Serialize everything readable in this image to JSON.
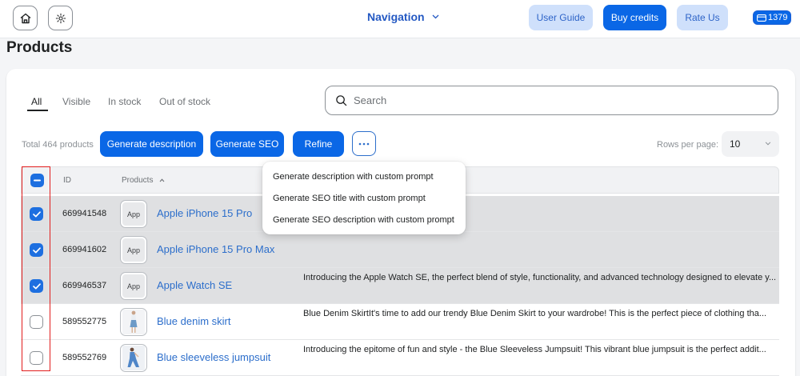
{
  "header": {
    "home_icon": "home-icon",
    "settings_icon": "gear-icon",
    "nav_label": "Navigation",
    "user_guide": "User Guide",
    "buy_credits": "Buy credits",
    "rate_us": "Rate Us",
    "credits_count": "1379"
  },
  "page_title": "Products",
  "tabs": [
    "All",
    "Visible",
    "In stock",
    "Out of stock"
  ],
  "search": {
    "placeholder": "Search"
  },
  "toolbar": {
    "total": "Total 464 products",
    "generate_description": "Generate description",
    "generate_seo": "Generate SEO",
    "refine": "Refine",
    "rows_per_page_label": "Rows per page:",
    "rows_per_page_value": "10"
  },
  "table": {
    "headers": {
      "id": "ID",
      "products": "Products"
    },
    "rows": [
      {
        "id": "669941548",
        "thumb": "App",
        "name": "Apple iPhone 15 Pro",
        "desc": "",
        "selected": true
      },
      {
        "id": "669941602",
        "thumb": "App",
        "name": "Apple iPhone 15 Pro Max",
        "desc": "",
        "selected": true
      },
      {
        "id": "669946537",
        "thumb": "App",
        "name": "Apple Watch SE",
        "desc": "Introducing the Apple Watch SE, the perfect blend of style, functionality, and advanced technology designed to elevate y...",
        "selected": true
      },
      {
        "id": "589552775",
        "thumb": "",
        "name": "Blue denim skirt",
        "desc": "Blue Denim SkirtIt's time to add our trendy Blue Denim Skirt to your wardrobe! This is the perfect piece of clothing tha...",
        "selected": false
      },
      {
        "id": "589552769",
        "thumb": "",
        "name": "Blue sleeveless jumpsuit",
        "desc": "Introducing the epitome of fun and style - the Blue Sleeveless Jumpsuit! This vibrant blue jumpsuit is the perfect addit...",
        "selected": false
      }
    ]
  },
  "more_menu": {
    "items": [
      "Generate description with custom prompt",
      "Generate SEO title with custom prompt",
      "Generate SEO description with custom prompt"
    ]
  },
  "colors": {
    "primary": "#0a67e6",
    "link": "#2c6ecb",
    "highlight_border": "#e21d1d"
  }
}
